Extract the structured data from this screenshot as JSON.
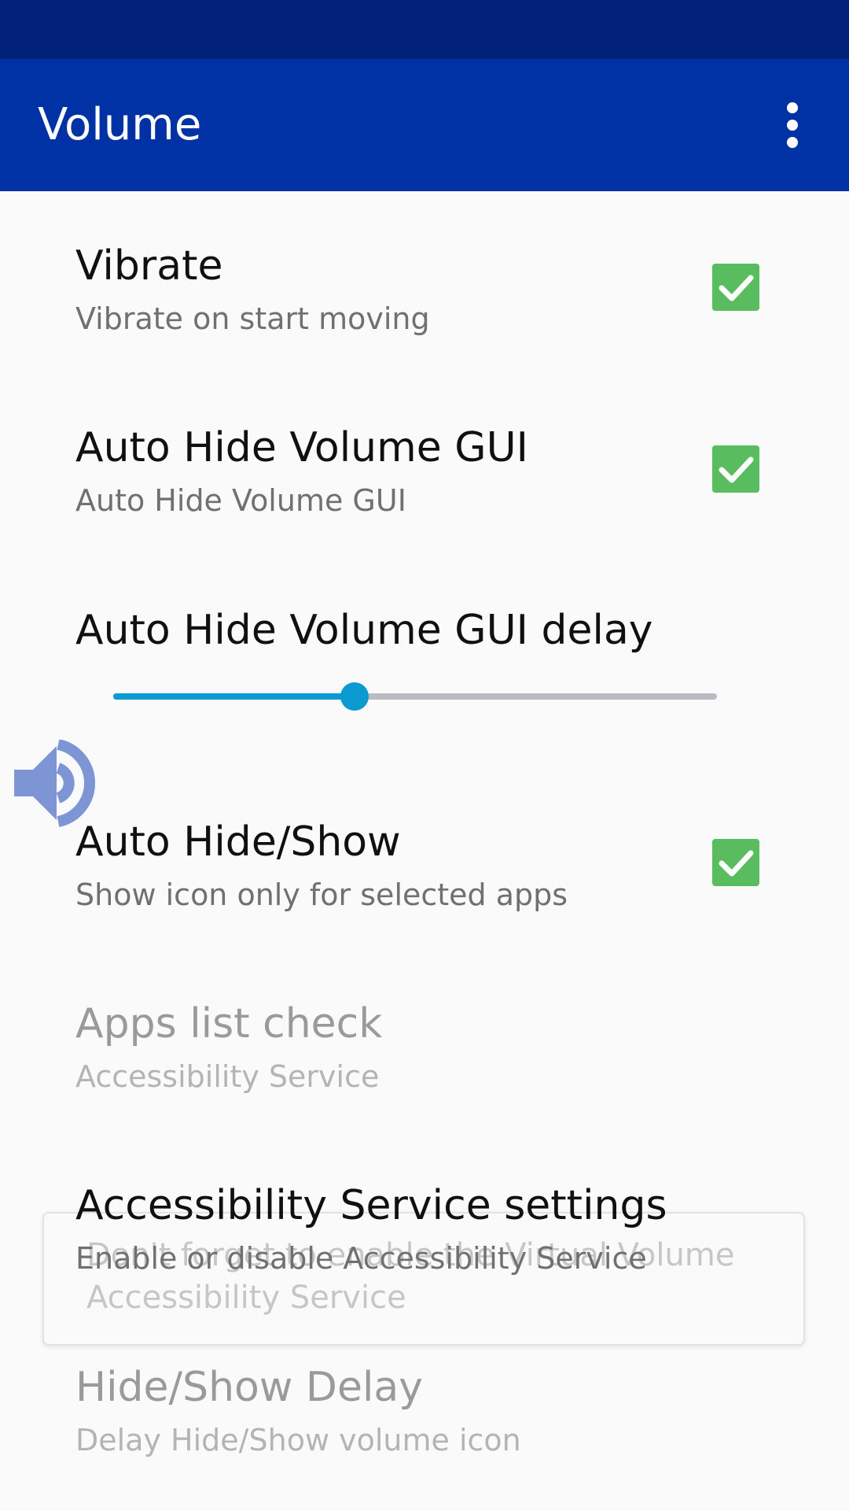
{
  "app_bar": {
    "title": "Volume",
    "overflow_icon": "more-vert-icon"
  },
  "colors": {
    "status_bar": "#002177",
    "app_bar": "#0031a5",
    "checkbox": "#59bd5f",
    "slider_accent": "#0a9ad0",
    "slider_track": "#b8bcc0"
  },
  "preferences": [
    {
      "title": "Vibrate",
      "summary": "Vibrate on start moving",
      "checked": true,
      "enabled": true
    },
    {
      "title": "Auto Hide Volume GUI",
      "summary": "Auto Hide Volume GUI",
      "checked": true,
      "enabled": true
    },
    {
      "title": "Auto Hide Volume GUI delay",
      "slider_value_fraction": 0.4,
      "enabled": true
    },
    {
      "title": "Auto Hide/Show",
      "summary": "Show icon only for selected apps",
      "checked": true,
      "enabled": true
    },
    {
      "title": "Apps list check",
      "summary": "Accessibility Service",
      "enabled": false
    },
    {
      "title": "Accessibility Service settings",
      "summary": "Enable or disable Accessibility Service",
      "enabled": true
    },
    {
      "title": "Hide/Show Delay",
      "summary": "Delay Hide/Show volume icon",
      "enabled": false
    }
  ],
  "floating_button": {
    "icon": "volume-up-icon",
    "color": "#7d95d5"
  },
  "toast": {
    "line1": "Don't forget to enable the Virtual Volume",
    "line2": "Accessibility Service"
  }
}
